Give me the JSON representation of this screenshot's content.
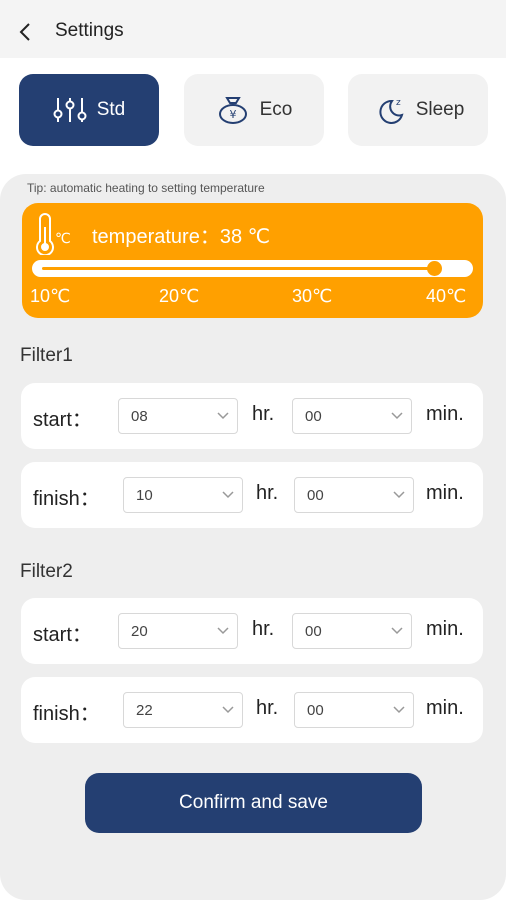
{
  "header": {
    "title": "Settings"
  },
  "modes": [
    {
      "label": "Std",
      "active": true
    },
    {
      "label": "Eco",
      "active": false
    },
    {
      "label": "Sleep",
      "active": false
    }
  ],
  "tip": "Tip: automatic heating to setting temperature",
  "temperature": {
    "label": "temperature：38 ℃",
    "value": 38,
    "min": 10,
    "max": 40,
    "ticks": [
      "10℃",
      "20℃",
      "30℃",
      "40℃"
    ]
  },
  "filters": [
    {
      "title": "Filter1",
      "start": {
        "label": "start：",
        "hour": "08",
        "minute": "00"
      },
      "finish": {
        "label": "finish：",
        "hour": "10",
        "minute": "00"
      }
    },
    {
      "title": "Filter2",
      "start": {
        "label": "start：",
        "hour": "20",
        "minute": "00"
      },
      "finish": {
        "label": "finish：",
        "hour": "22",
        "minute": "00"
      }
    }
  ],
  "units": {
    "hour": "hr.",
    "minute": "min."
  },
  "confirm_label": "Confirm and save",
  "colors": {
    "primary": "#243f72",
    "accent": "#ffa000",
    "panel": "#eeeeee"
  }
}
